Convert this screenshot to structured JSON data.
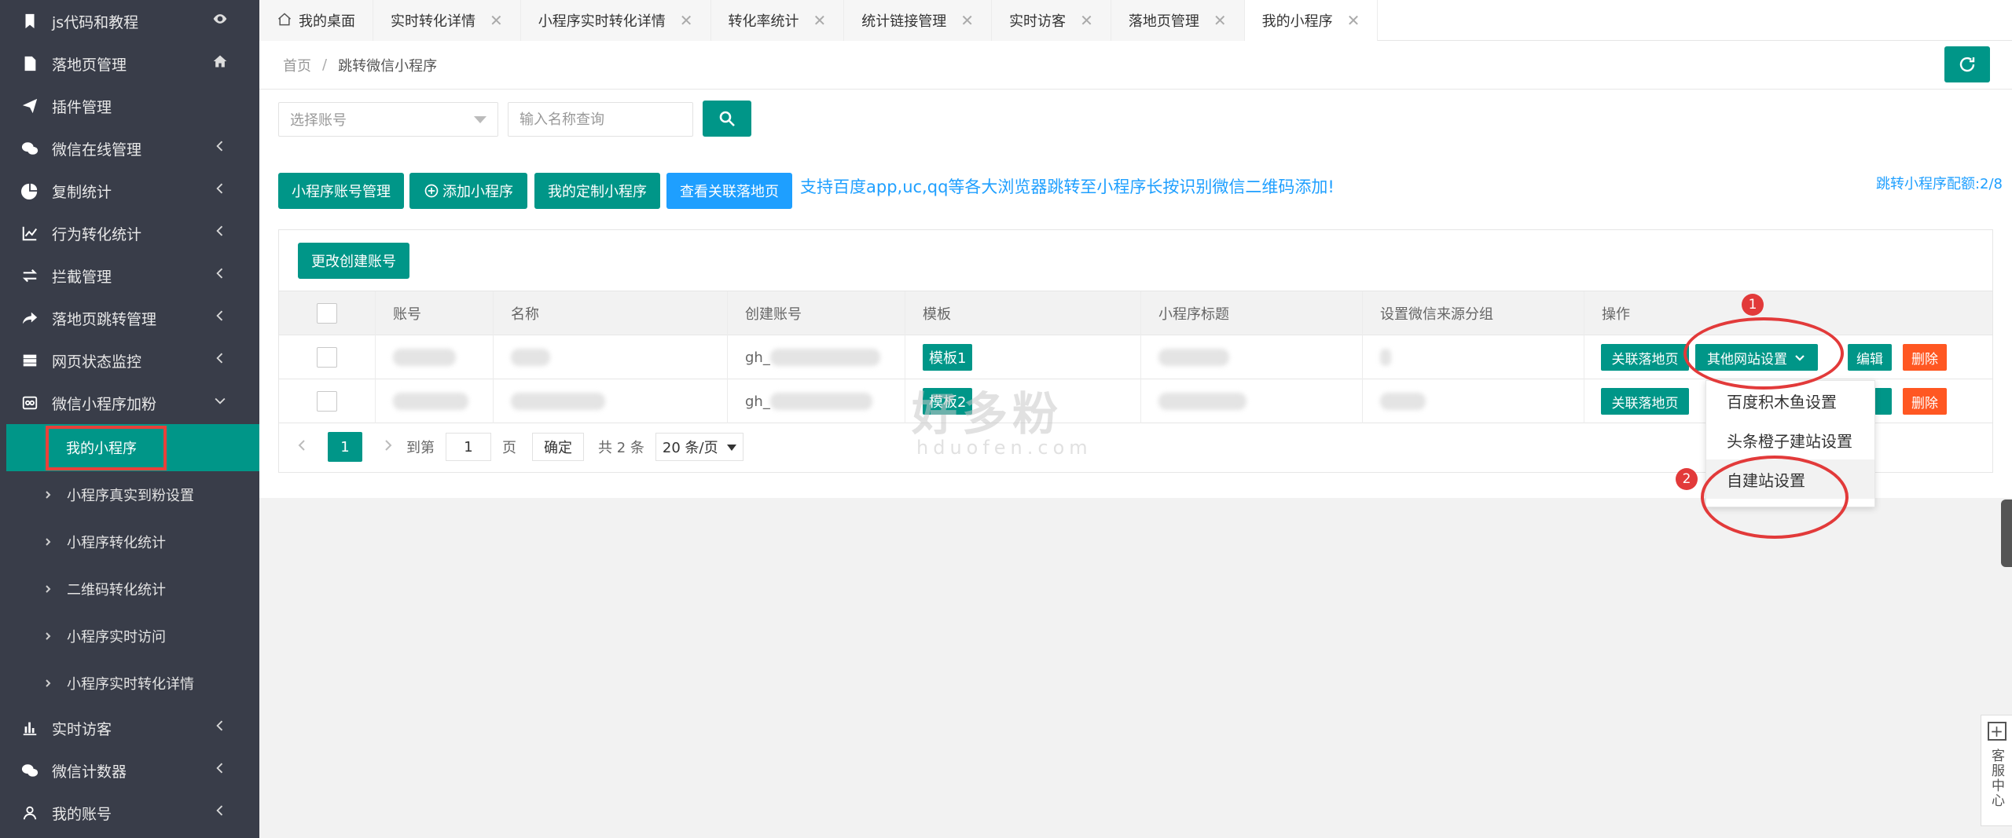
{
  "sidebar": {
    "items": [
      {
        "label": "js代码和教程",
        "icon": "bookmark-icon",
        "right": "eye-icon"
      },
      {
        "label": "落地页管理",
        "icon": "document-icon",
        "right": "home-icon"
      },
      {
        "label": "插件管理",
        "icon": "paper-plane-icon",
        "right": ""
      },
      {
        "label": "微信在线管理",
        "icon": "wechat-icon",
        "right": "chevron-left-icon"
      },
      {
        "label": "复制统计",
        "icon": "pie-chart-icon",
        "right": "chevron-left-icon"
      },
      {
        "label": "行为转化统计",
        "icon": "line-chart-icon",
        "right": "chevron-left-icon"
      },
      {
        "label": "拦截管理",
        "icon": "exchange-icon",
        "right": "chevron-left-icon"
      },
      {
        "label": "落地页跳转管理",
        "icon": "share-icon",
        "right": "chevron-left-icon"
      },
      {
        "label": "网页状态监控",
        "icon": "server-icon",
        "right": "chevron-left-icon"
      },
      {
        "label": "微信小程序加粉",
        "icon": "miniprogram-icon",
        "right": "chevron-down-icon"
      }
    ],
    "sub_items": [
      {
        "label": "我的小程序",
        "active": true
      },
      {
        "label": "小程序真实到粉设置"
      },
      {
        "label": "小程序转化统计"
      },
      {
        "label": "二维码转化统计"
      },
      {
        "label": "小程序实时访问"
      },
      {
        "label": "小程序实时转化详情"
      }
    ],
    "bottom_items": [
      {
        "label": "实时访客",
        "icon": "bar-chart-icon"
      },
      {
        "label": "微信计数器",
        "icon": "wechat-icon"
      },
      {
        "label": "我的账号",
        "icon": "user-icon"
      }
    ]
  },
  "tabs": [
    {
      "label": "我的桌面",
      "closable": false
    },
    {
      "label": "实时转化详情",
      "closable": true
    },
    {
      "label": "小程序实时转化详情",
      "closable": true
    },
    {
      "label": "转化率统计",
      "closable": true
    },
    {
      "label": "统计链接管理",
      "closable": true
    },
    {
      "label": "实时访客",
      "closable": true
    },
    {
      "label": "落地页管理",
      "closable": true
    },
    {
      "label": "我的小程序",
      "closable": true,
      "active": true
    }
  ],
  "breadcrumb": {
    "home": "首页",
    "sep": "/",
    "current": "跳转微信小程序"
  },
  "filters": {
    "account_placeholder": "选择账号",
    "name_placeholder": "输入名称查询"
  },
  "toolbar": {
    "account_mgmt": "小程序账号管理",
    "add": "添加小程序",
    "custom": "我的定制小程序",
    "linked": "查看关联落地页",
    "info": "支持百度app,uc,qq等各大浏览器跳转至小程序长按识别微信二维码添加!",
    "count": "跳转小程序配额:2/8"
  },
  "table": {
    "change_account": "更改创建账号",
    "headers": [
      "账号",
      "名称",
      "创建账号",
      "模板",
      "小程序标题",
      "设置微信来源分组",
      "操作"
    ],
    "rows": [
      {
        "account": "",
        "name": "",
        "creator": "gh_",
        "template": "模板1",
        "title": "",
        "group": ""
      },
      {
        "account": "",
        "name": "",
        "creator": "gh_",
        "template": "模板2",
        "title": "",
        "group": ""
      }
    ],
    "actions": {
      "linked": "关联落地页",
      "other": "其他网站设置",
      "edit": "编辑",
      "delete": "删除"
    }
  },
  "pager": {
    "current": "1",
    "goto": "到第",
    "page_input": "1",
    "page_unit": "页",
    "confirm": "确定",
    "total": "共 2 条",
    "page_size": "20 条/页"
  },
  "dropdown": {
    "items": [
      "百度积木鱼设置",
      "头条橙子建站设置",
      "自建站设置"
    ]
  },
  "annotations": {
    "badge1": "1",
    "badge2": "2"
  },
  "watermark": {
    "main": "好多粉",
    "sub": "hduofen.com"
  },
  "service": {
    "label": "客服中心"
  },
  "colors": {
    "primary": "#009688",
    "blue": "#1e9fff",
    "red": "#ff5722",
    "sidebar": "#393d49",
    "annotation": "#e23a3a"
  }
}
